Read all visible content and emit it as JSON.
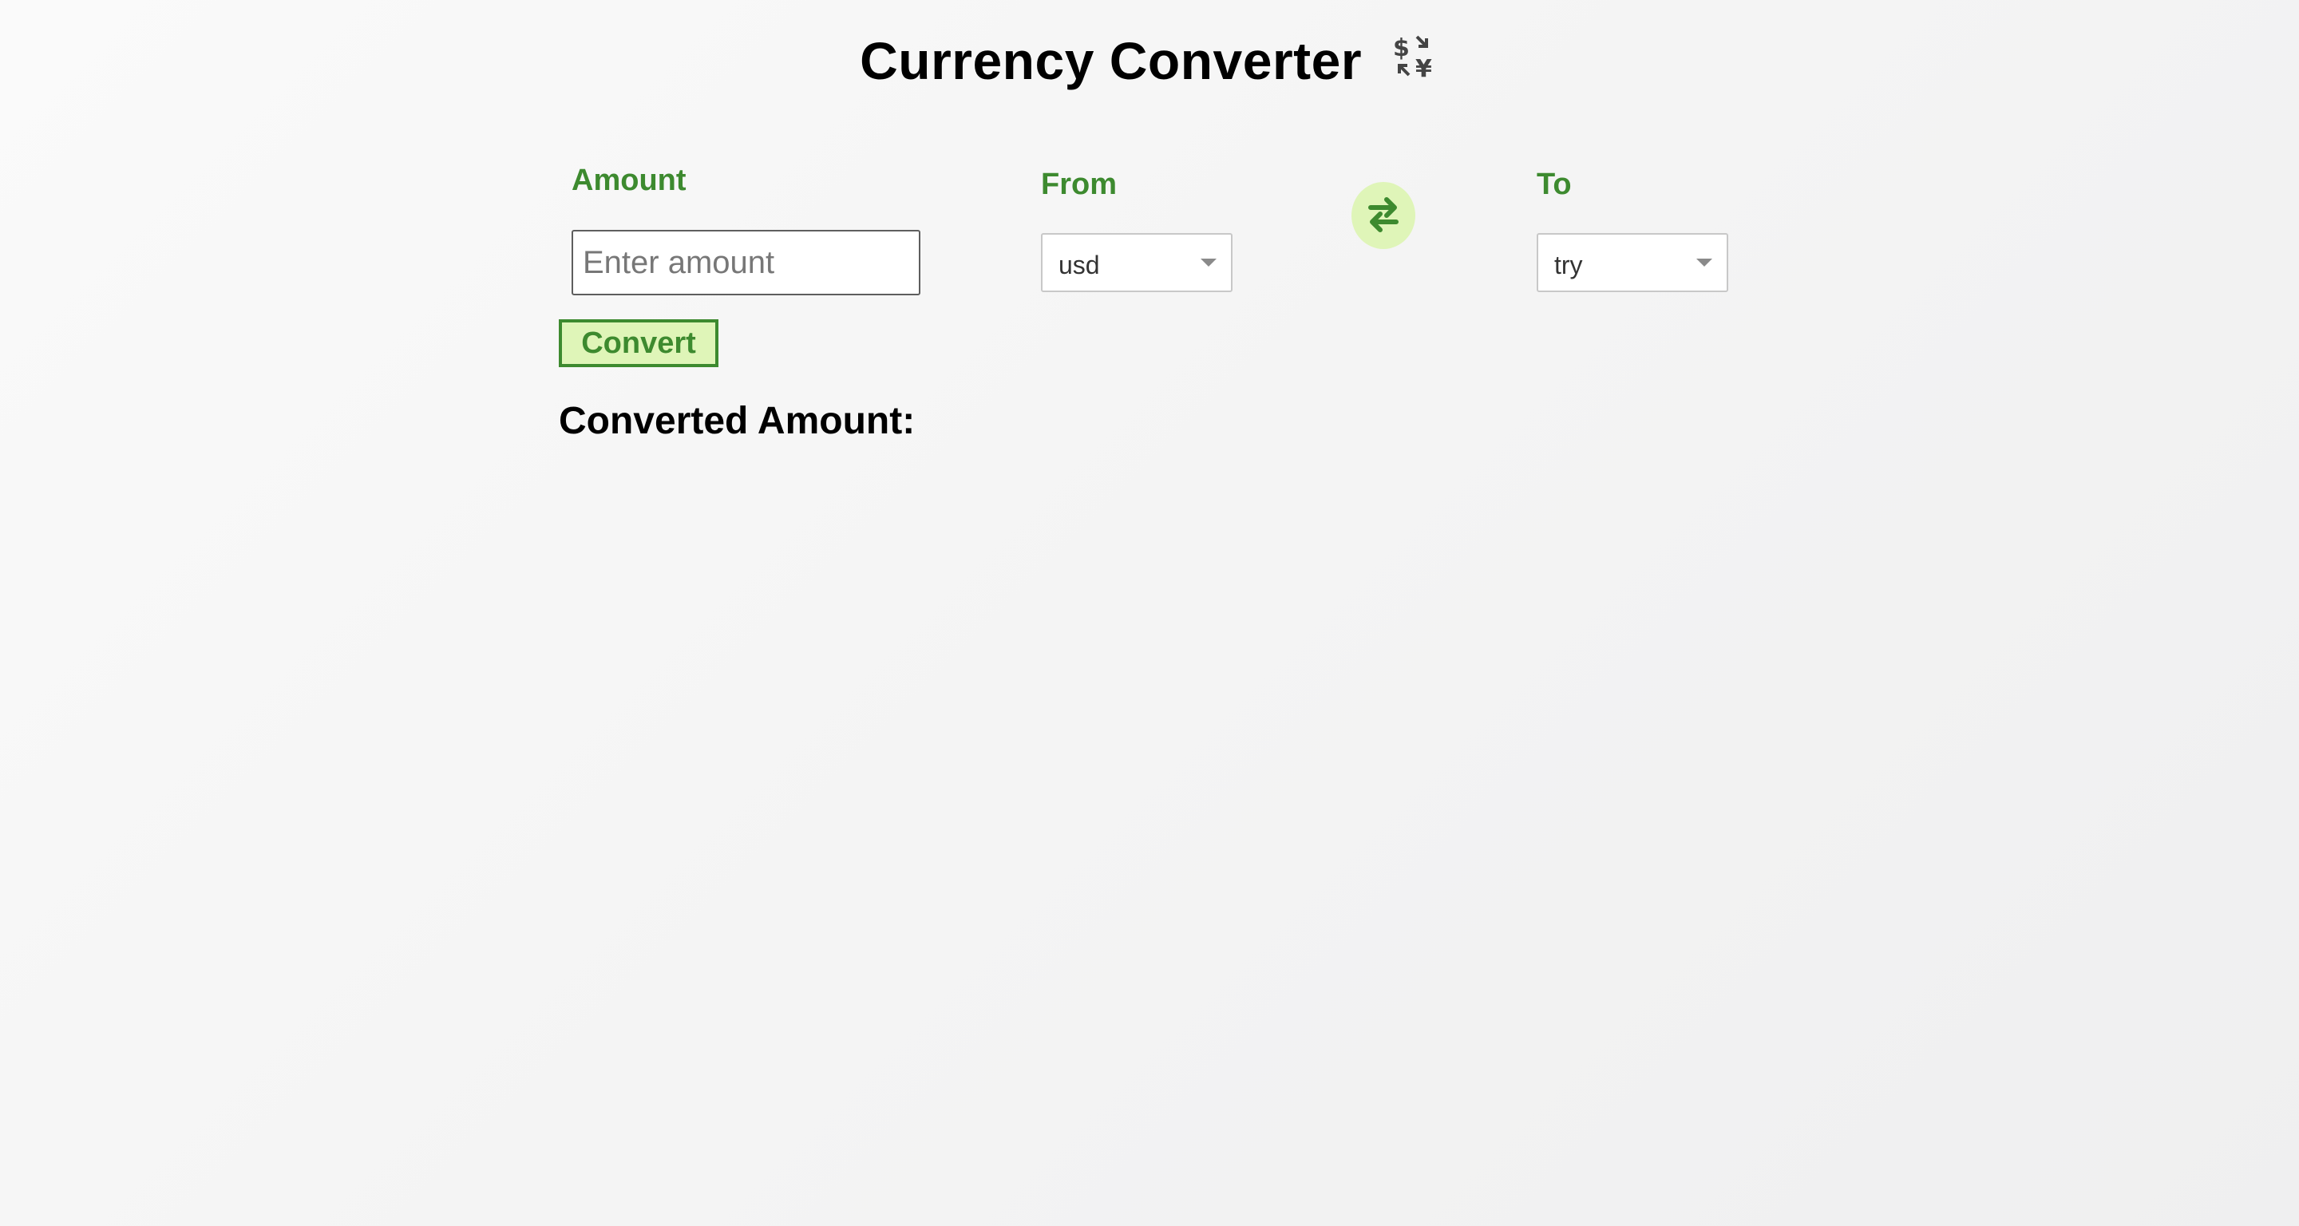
{
  "header": {
    "title": "Currency Converter",
    "icon": "currency-exchange-icon"
  },
  "amount": {
    "label": "Amount",
    "placeholder": "Enter amount",
    "value": ""
  },
  "from": {
    "label": "From",
    "selected": "usd"
  },
  "swap": {
    "icon": "swap-arrows-icon"
  },
  "to": {
    "label": "To",
    "selected": "try"
  },
  "convert": {
    "label": "Convert"
  },
  "result": {
    "label": "Converted Amount:",
    "value": ""
  },
  "colors": {
    "accent_green": "#3d8a2f",
    "light_green": "#dff5b8",
    "title_text": "#000000"
  }
}
